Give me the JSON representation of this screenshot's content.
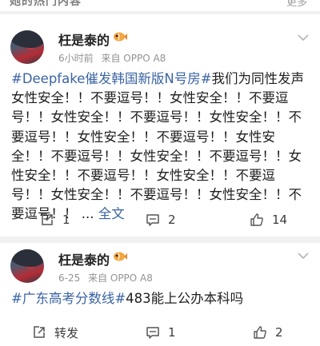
{
  "header": {
    "section_title": "她的热门内容",
    "more_label": "更多"
  },
  "posts": [
    {
      "author": "枉是泰的",
      "time": "6小时前",
      "source": "来自 OPPO A8",
      "hashtag": "#Deepfake催发韩国新版N号房#",
      "body": "我们为同性发声 女性安全！！不要逗号！！女性安全！！不要逗号！！女性安全！！不要逗号！！女性安全！！不要逗号！！女性安全！！不要逗号！！女性安全！！不要逗号！！女性安全！！不要逗号！！女性安全！！不要逗号！！女性安全！！不要逗号！！女性安全！！不要逗号！！女性安全！！不要逗号！！ ...",
      "expand_label": "全文",
      "repost_count": "1",
      "comment_count": "2",
      "like_count": "14"
    },
    {
      "author": "枉是泰的",
      "time": "6-25",
      "source": "来自 OPPO A8",
      "hashtag": "#广东高考分数线#",
      "body": "483能上公办本科吗",
      "repost_label": "转发",
      "comment_count": "1",
      "like_count": "2"
    }
  ],
  "icons": {
    "repost": "share-icon",
    "comment": "comment-icon",
    "like": "thumbs-up-icon",
    "menu": "chevron-down-icon",
    "emoji": "fish-emoji-icon"
  },
  "colors": {
    "link": "#3a63a3",
    "meta": "#939393",
    "background": "#f1f1f1"
  }
}
